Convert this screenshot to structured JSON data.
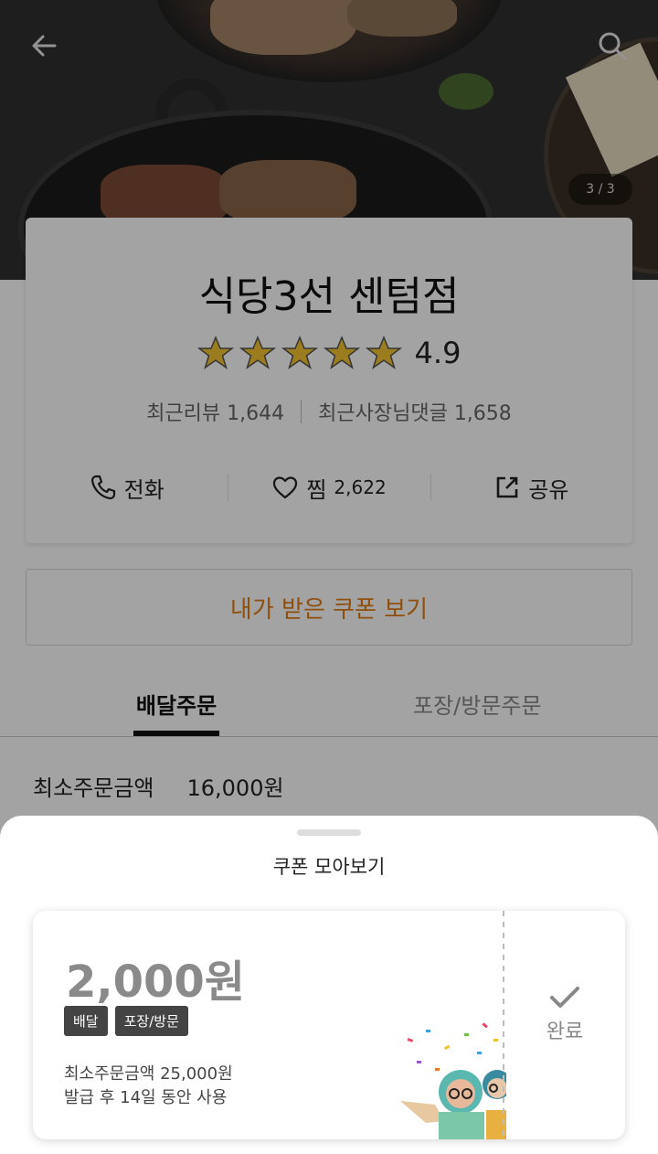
{
  "header": {
    "back_icon": "arrow-left-icon",
    "search_icon": "search-icon",
    "image_pager": "3 / 3"
  },
  "store": {
    "name": "식당3선 센텀점",
    "rating": "4.9",
    "stars": 5,
    "recent_reviews": "최근리뷰 1,644",
    "recent_owner_replies": "최근사장님댓글 1,658"
  },
  "actions": {
    "call_label": "전화",
    "like_label": "찜",
    "like_count": "2,622",
    "share_label": "공유"
  },
  "coupon_button_label": "내가 받은 쿠폰 보기",
  "tabs": [
    {
      "label": "배달주문",
      "active": true
    },
    {
      "label": "포장/방문주문",
      "active": false
    }
  ],
  "min_order": {
    "label": "최소주문금액",
    "value": "16,000원"
  },
  "sheet": {
    "title": "쿠폰 모아보기",
    "coupon": {
      "amount": "2,000원",
      "tags": [
        "배달",
        "포장/방문"
      ],
      "min_order": "최소주문금액 25,000원",
      "validity": "발급 후 14일 동안 사용",
      "status_label": "완료"
    }
  },
  "colors": {
    "accent_orange": "#e07d17",
    "star_gold": "#f2c230",
    "tag_bg": "#444444"
  }
}
